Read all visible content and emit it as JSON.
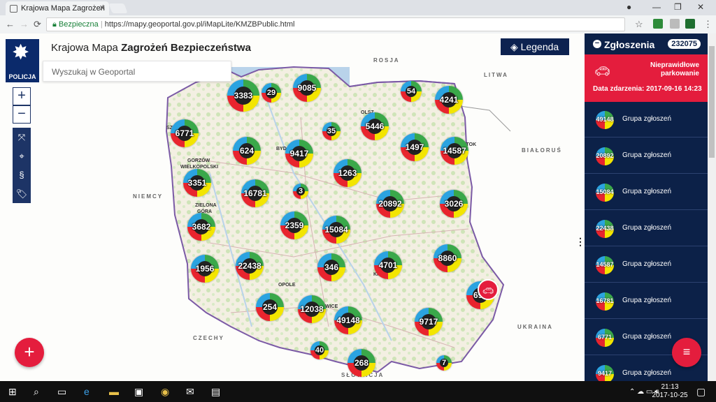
{
  "browser": {
    "tab_title": "Krajowa Mapa Zagrożeń",
    "secure_label": "Bezpieczna",
    "url": "https://mapy.geoportal.gov.pl/iMapLite/KMZBPublic.html"
  },
  "app": {
    "logo_text": "POLICJA",
    "title_plain": "Krajowa Mapa",
    "title_bold": "Zagrożeń Bezpieczeństwa",
    "search_placeholder": "Wyszukaj w Geoportal",
    "zoom_in": "+",
    "zoom_out": "−",
    "legend_label": "Legenda"
  },
  "map": {
    "countries": [
      "ROSJA",
      "LITWA",
      "BIAŁORUŚ",
      "NIEMCY",
      "CZECHY",
      "UKRAINA",
      "SŁOWACJA"
    ],
    "cities": [
      "SZ",
      "GORZÓW",
      "WIELKOPOLSKI",
      "BYD",
      "ZIELONA",
      "GÓRA",
      "OPOLE",
      "OLSZ",
      "ATOK",
      "KI",
      "WICE"
    ],
    "clusters": [
      "3383",
      "29",
      "9085",
      "54",
      "4241",
      "6771",
      "35",
      "5446",
      "624",
      "9417",
      "1497",
      "14587",
      "1263",
      "3351",
      "16781",
      "3",
      "20892",
      "3026",
      "3682",
      "2359",
      "15084",
      "1956",
      "22438",
      "346",
      "4701",
      "8860",
      "696",
      "254",
      "12038",
      "49148",
      "9717",
      "40",
      "268",
      "7"
    ]
  },
  "panel": {
    "header": "Zgłoszenia",
    "count": "232075",
    "alert": {
      "type": "Nieprawidłowe parkowanie",
      "date": "Data zdarzenia: 2017-09-16 14:23"
    },
    "groups": [
      {
        "count": "49148",
        "label": "Grupa zgłoszeń"
      },
      {
        "count": "20892",
        "label": "Grupa zgłoszeń"
      },
      {
        "count": "15084",
        "label": "Grupa zgłoszeń"
      },
      {
        "count": "22438",
        "label": "Grupa zgłoszeń"
      },
      {
        "count": "14587",
        "label": "Grupa zgłoszeń"
      },
      {
        "count": "16781",
        "label": "Grupa zgłoszeń"
      },
      {
        "count": "6771",
        "label": "Grupa zgłoszeń"
      },
      {
        "count": "9417",
        "label": "Grupa zgłoszeń"
      }
    ]
  },
  "taskbar": {
    "time": "21:13",
    "date": "2017-10-25"
  },
  "colors": {
    "navy": "#0c2148",
    "red": "#e41d3d",
    "cluster_red": "#e8242e",
    "cluster_yellow": "#f3e500",
    "cluster_green": "#3aa84a",
    "cluster_blue": "#2ba3e0"
  }
}
